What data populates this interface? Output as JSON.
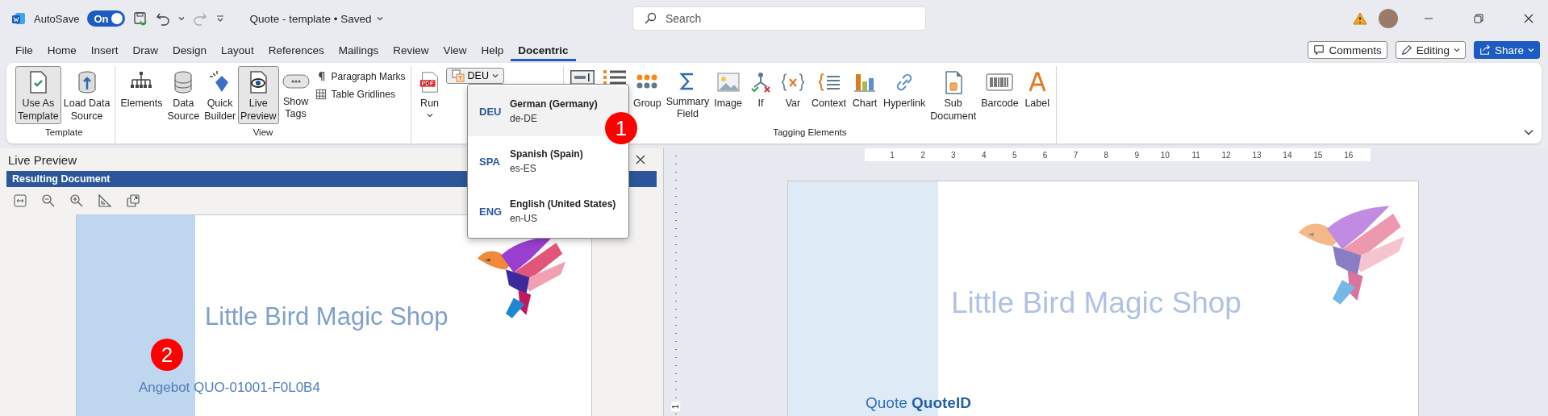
{
  "title_bar": {
    "autosave": {
      "label": "AutoSave",
      "on": true,
      "state": "On"
    },
    "document_title": "Quote - template • Saved",
    "search": {
      "placeholder": "Search"
    }
  },
  "menu_tabs": [
    {
      "label": "File",
      "selected": false
    },
    {
      "label": "Home",
      "selected": false
    },
    {
      "label": "Insert",
      "selected": false
    },
    {
      "label": "Draw",
      "selected": false
    },
    {
      "label": "Design",
      "selected": false
    },
    {
      "label": "Layout",
      "selected": false
    },
    {
      "label": "References",
      "selected": false
    },
    {
      "label": "Mailings",
      "selected": false
    },
    {
      "label": "Review",
      "selected": false
    },
    {
      "label": "View",
      "selected": false
    },
    {
      "label": "Help",
      "selected": false
    },
    {
      "label": "Docentric",
      "selected": true
    }
  ],
  "actions": [
    {
      "label": "Comments",
      "kind": "comments"
    },
    {
      "label": "Editing",
      "kind": "mode"
    },
    {
      "label": "Share",
      "kind": "share"
    }
  ],
  "ribbon": {
    "groups": [
      {
        "label": "Template",
        "items": [
          {
            "kind": "large",
            "label": "Use As\nTemplate",
            "pressed": true
          },
          {
            "kind": "large",
            "label": "Load Data\nSource",
            "pressed": false
          }
        ]
      },
      {
        "label": "View",
        "items": [
          {
            "kind": "large",
            "label": "Elements",
            "pressed": false
          },
          {
            "kind": "large",
            "label": "Data\nSource",
            "pressed": false
          },
          {
            "kind": "large",
            "label": "Quick\nBuilder",
            "pressed": false
          },
          {
            "kind": "large",
            "label": "Live\nPreview",
            "pressed": true
          },
          {
            "kind": "large",
            "label": "Show\nTags",
            "pressed": false
          },
          {
            "kind": "small",
            "label": "Paragraph Marks"
          },
          {
            "kind": "small",
            "label": "Table Gridlines"
          }
        ]
      },
      {
        "items": [
          {
            "kind": "large",
            "label": "Run",
            "pressed": false,
            "menu": true
          },
          {
            "kind": "dropdown",
            "label": "DEU"
          }
        ]
      },
      {
        "label": "Tagging Elements",
        "items": [
          {
            "kind": "large",
            "pressed": false
          },
          {
            "kind": "large",
            "pressed": false
          },
          {
            "kind": "large",
            "label": "Group",
            "pressed": false
          },
          {
            "kind": "large",
            "label": "Summary\nField",
            "pressed": false
          },
          {
            "kind": "large",
            "label": "Image",
            "pressed": false
          },
          {
            "kind": "large",
            "label": "If",
            "pressed": false
          },
          {
            "kind": "large",
            "label": "Var",
            "pressed": false
          },
          {
            "kind": "large",
            "label": "Context",
            "pressed": false
          },
          {
            "kind": "large",
            "label": "Chart",
            "pressed": false
          },
          {
            "kind": "large",
            "label": "Hyperlink",
            "pressed": false
          },
          {
            "kind": "large",
            "label": "Sub\nDocument",
            "pressed": false
          },
          {
            "kind": "large",
            "label": "Barcode",
            "pressed": false
          },
          {
            "kind": "large",
            "label": "Label",
            "pressed": false
          }
        ]
      }
    ]
  },
  "language_menu": {
    "callout": "1",
    "items": [
      {
        "code": "DEU",
        "name": "German (Germany)",
        "locale": "de-DE",
        "selected": true
      },
      {
        "code": "SPA",
        "name": "Spanish (Spain)",
        "locale": "es-ES",
        "selected": false
      },
      {
        "code": "ENG",
        "name": "English (United States)",
        "locale": "en-US",
        "selected": false
      }
    ]
  },
  "live_preview": {
    "title": "Live Preview",
    "header": "Resulting Document",
    "callout": "2",
    "document": {
      "shop_name": "Little Bird Magic Shop",
      "heading": "Angebot QUO-01001-F0L0B4"
    }
  },
  "editor": {
    "ruler": {
      "horizontal": [
        "1",
        "2",
        "3",
        "4",
        "5",
        "6",
        "7",
        "8",
        "9",
        "10",
        "11",
        "12",
        "13",
        "14",
        "15",
        "16"
      ],
      "vertical": [
        "1"
      ]
    },
    "document": {
      "shop_name": "Little Bird Magic Shop",
      "heading": "Quote **QuoteID**"
    }
  }
}
